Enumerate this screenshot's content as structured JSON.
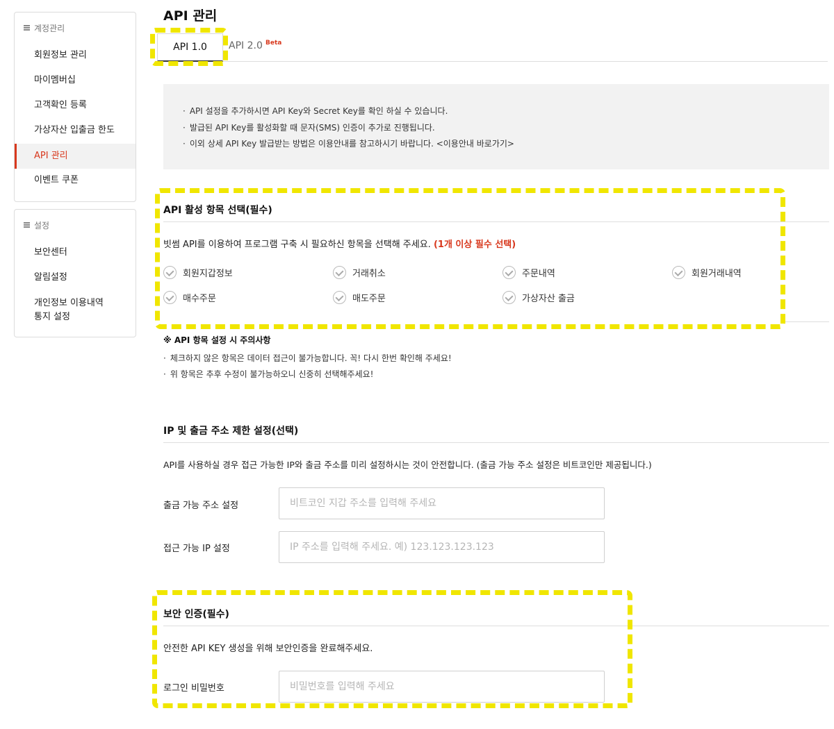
{
  "sidebar": {
    "account_header": "계정관리",
    "account_items": [
      {
        "label": "회원정보 관리"
      },
      {
        "label": "마이멤버십"
      },
      {
        "label": "고객확인 등록"
      },
      {
        "label": "가상자산 입출금 한도"
      },
      {
        "label": "API 관리",
        "active": true
      },
      {
        "label": "이벤트 쿠폰"
      }
    ],
    "settings_header": "설정",
    "settings_items": [
      {
        "label": "보안센터"
      },
      {
        "label": "알림설정"
      },
      {
        "label": "개인정보 이용내역\n통지 설정"
      }
    ]
  },
  "page": {
    "title": "API 관리",
    "tabs": [
      {
        "label": "API 1.0",
        "active": true
      },
      {
        "label": "API 2.0",
        "badge": "Beta"
      }
    ]
  },
  "notice": [
    "API 설정을 추가하시면 API Key와 Secret Key를 확인 하실 수 있습니다.",
    "발급된 API Key를 활성화할 때 문자(SMS) 인증이 추가로 진행됩니다.",
    "이외 상세 API Key 발급받는 방법은 이용안내를 참고하시기 바랍니다. <이용안내 바로가기>"
  ],
  "api_scope": {
    "title": "API 활성 항목 선택(필수)",
    "desc": "빗썸 API를 이용하여 프로그램 구축 시 필요하신 항목을 선택해 주세요.",
    "required_note": "(1개 이상 필수 선택)",
    "options": [
      "회원지갑정보",
      "거래취소",
      "주문내역",
      "회원거래내역",
      "매수주문",
      "매도주문",
      "가상자산 출금"
    ]
  },
  "caution": {
    "title": "※ API 항목 설정 시 주의사항",
    "items": [
      "체크하지 않은 항목은 데이터 접근이 불가능합니다. 꼭! 다시 한번 확인해 주세요!",
      "위 항목은 추후 수정이 불가능하오니 신중히 선택해주세요!"
    ]
  },
  "ip_section": {
    "title": "IP 및 출금 주소 제한 설정(선택)",
    "desc": "API를 사용하실 경우 접근 가능한 IP와 출금 주소를 미리 설정하시는 것이 안전합니다. (출금 가능 주소 설정은 비트코인만 제공됩니다.)",
    "withdraw_label": "출금 가능 주소 설정",
    "withdraw_placeholder": "비트코인 지갑 주소를 입력해 주세요",
    "withdraw_value": "",
    "ip_label": "접근 가능 IP 설정",
    "ip_placeholder": "IP 주소를 입력해 주세요. 예) 123.123.123.123",
    "ip_value": ""
  },
  "security": {
    "title": "보안 인증(필수)",
    "desc": "안전한 API KEY 생성을 위해 보안인증을 완료해주세요.",
    "password_label": "로그인 비밀번호",
    "password_placeholder": "비밀번호를 입력해 주세요",
    "password_value": ""
  },
  "colors": {
    "accent_red": "#d8381d",
    "highlight_yellow": "#f0e600",
    "notice_bg": "#f2f2f2"
  }
}
